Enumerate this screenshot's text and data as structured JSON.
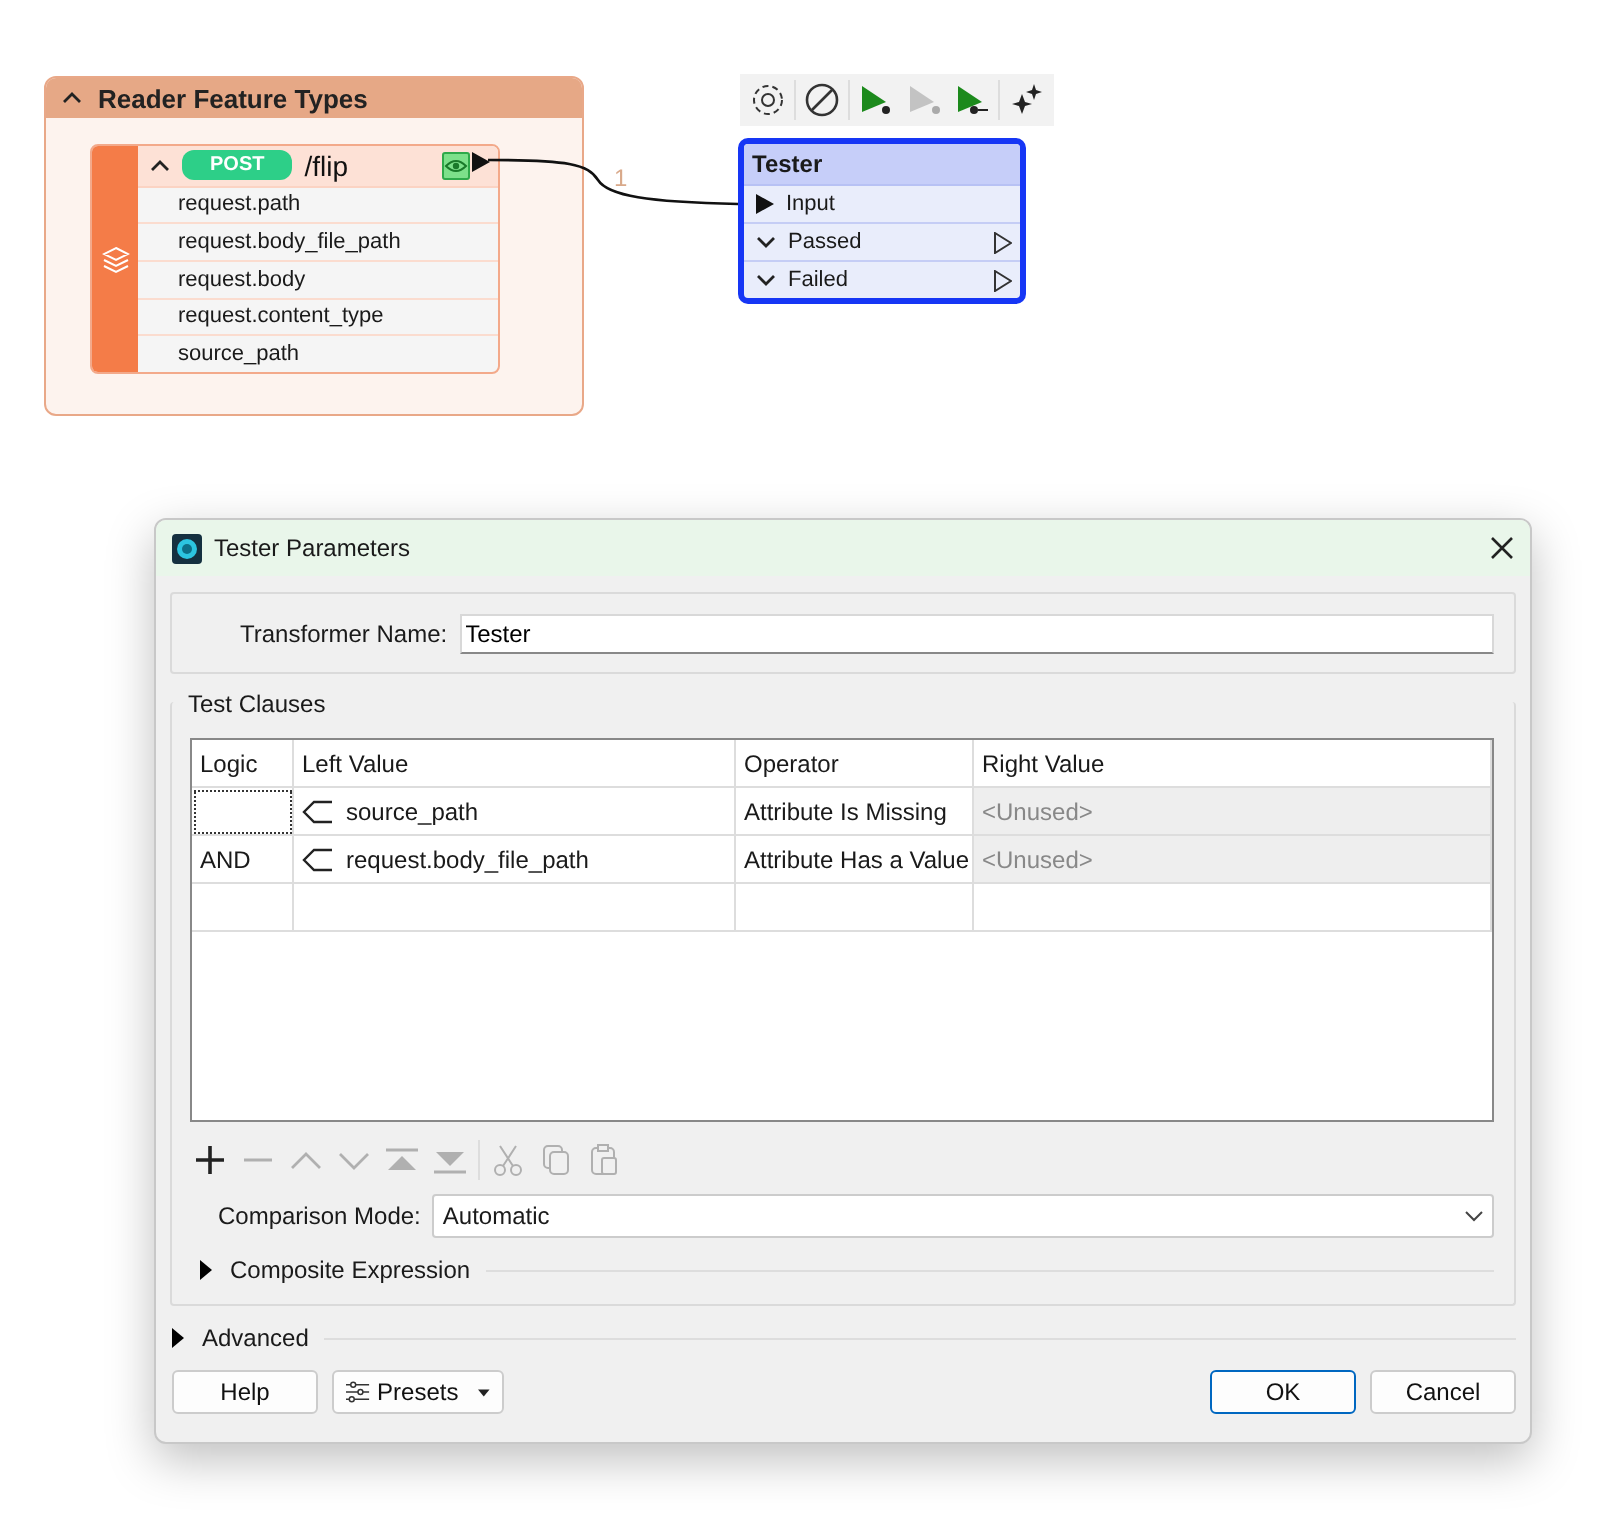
{
  "canvas": {
    "reader_group": {
      "title": "Reader Feature Types",
      "expanded": true
    },
    "feature_type": {
      "method": "POST",
      "name": "/flip",
      "expanded": true,
      "attributes": [
        "request.path",
        "request.body_file_path",
        "request.body",
        "request.content_type",
        "source_path"
      ]
    },
    "connection": {
      "label": "1"
    },
    "node_toolbar": [
      {
        "kind": "gear"
      },
      {
        "kind": "disable"
      },
      {
        "kind": "run",
        "disabled": false
      },
      {
        "kind": "run-to",
        "disabled": true
      },
      {
        "kind": "run-from",
        "disabled": false
      },
      {
        "kind": "sparkle"
      }
    ],
    "tester_node": {
      "title": "Tester",
      "ports": [
        {
          "name": "Input",
          "kind": "input"
        },
        {
          "name": "Passed",
          "kind": "output"
        },
        {
          "name": "Failed",
          "kind": "output"
        }
      ]
    }
  },
  "dialog": {
    "title": "Tester Parameters",
    "transformer_name": {
      "label": "Transformer Name:",
      "value": "Tester"
    },
    "test_clauses": {
      "title": "Test Clauses",
      "columns": [
        "Logic",
        "Left Value",
        "Operator",
        "Right Value"
      ],
      "rows": [
        {
          "left_value": "source_path",
          "operator": "Attribute Is Missing",
          "right_value": "<Unused>",
          "focused": true,
          "disabled": true
        },
        {
          "logic": "AND",
          "left_value": "request.body_file_path",
          "operator": "Attribute Has a Value",
          "right_value": "<Unused>",
          "focused": false,
          "disabled": true
        }
      ],
      "toolbar": [
        {
          "kind": "add",
          "disabled": false
        },
        {
          "kind": "remove",
          "disabled": true
        },
        {
          "kind": "up",
          "disabled": true
        },
        {
          "kind": "down",
          "disabled": true
        },
        {
          "kind": "top",
          "disabled": true
        },
        {
          "kind": "bottom",
          "disabled": true
        },
        {
          "kind": "cut",
          "disabled": true
        },
        {
          "kind": "copy",
          "disabled": true
        },
        {
          "kind": "paste",
          "disabled": true
        }
      ],
      "comparison_mode": {
        "label": "Comparison Mode:",
        "value": "Automatic"
      },
      "composite_expression": {
        "label": "Composite Expression",
        "expanded": false
      }
    },
    "advanced": {
      "label": "Advanced",
      "expanded": false
    },
    "buttons": [
      {
        "label": "Help",
        "kind": "plain",
        "default": false
      },
      {
        "label": "Presets",
        "kind": "menu",
        "default": false
      },
      {
        "label": "OK",
        "kind": "plain",
        "default": true
      },
      {
        "label": "Cancel",
        "kind": "plain",
        "default": false
      }
    ]
  }
}
